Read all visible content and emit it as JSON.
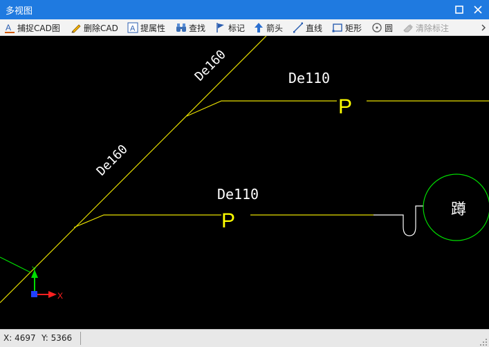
{
  "window": {
    "title": "多视图"
  },
  "toolbar": {
    "items": [
      {
        "label": "捕捉CAD图",
        "icon": "capture-cad-icon",
        "enabled": true
      },
      {
        "label": "删除CAD",
        "icon": "pencil-icon",
        "enabled": true
      },
      {
        "label": "提属性",
        "icon": "text-a-icon",
        "enabled": true
      },
      {
        "label": "查找",
        "icon": "binoculars-icon",
        "enabled": true
      },
      {
        "label": "标记",
        "icon": "flag-icon",
        "enabled": true
      },
      {
        "label": "箭头",
        "icon": "arrow-up-icon",
        "enabled": true
      },
      {
        "label": "直线",
        "icon": "line-icon",
        "enabled": true
      },
      {
        "label": "矩形",
        "icon": "rectangle-icon",
        "enabled": true
      },
      {
        "label": "圆",
        "icon": "circle-icon",
        "enabled": true
      },
      {
        "label": "清除标注",
        "icon": "eraser-icon",
        "enabled": false
      }
    ]
  },
  "drawing": {
    "pipe_label_upper": "De160",
    "pipe_label_lower": "De160",
    "branch_label_upper": "De110",
    "branch_label_lower": "De110",
    "trap_marker_upper": "P",
    "trap_marker_lower": "P",
    "fixture_label": "蹲",
    "axis_x_label": "X",
    "axis_y_label": "Y",
    "colors": {
      "background": "#000000",
      "pipe": "#e8e000",
      "text": "#ffffff",
      "marker": "#ffff00",
      "circle": "#00dd00"
    }
  },
  "status": {
    "x_text": "X: 4697",
    "y_text": "Y: 5366"
  }
}
